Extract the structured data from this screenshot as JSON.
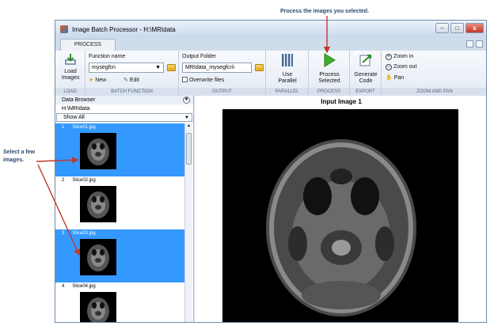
{
  "annotations": {
    "process_note": "Process the images you selected.",
    "select_note": "Select a few images."
  },
  "window": {
    "title": "Image Batch Processor - H:\\MRIdata",
    "buttons": [
      "–",
      "□",
      "x"
    ]
  },
  "tab": {
    "label": "PROCESS"
  },
  "sections": {
    "load": {
      "title": "LOAD",
      "button": "Load Images"
    },
    "batch_function": {
      "title": "BATCH FUNCTION",
      "label": "Function name",
      "value": "mysegfcn",
      "new": "New",
      "edit": "Edit"
    },
    "output": {
      "title": "OUTPUT",
      "label": "Output Folder",
      "value": "MRIdata_mysegfcn\\",
      "overwrite": "Overwrite files"
    },
    "parallel": {
      "title": "PARALLEL",
      "button": "Use Parallel"
    },
    "process": {
      "title": "PROCESS",
      "button": "Process Selected"
    },
    "export": {
      "title": "EXPORT",
      "button": "Generate Code"
    },
    "zoom_pan": {
      "title": "ZOOM AND PAN",
      "zoom_in": "Zoom in",
      "zoom_out": "Zoom out",
      "pan": "Pan"
    }
  },
  "data_browser": {
    "title": "Data Browser",
    "path": "H:\\MRIdata",
    "filter": "Show All",
    "items": [
      {
        "num": "1",
        "name": "Slice01.jpg",
        "selected": true
      },
      {
        "num": "2",
        "name": "Slice02.jpg",
        "selected": false
      },
      {
        "num": "3",
        "name": "Slice03.jpg",
        "selected": true
      },
      {
        "num": "4",
        "name": "Slice04.jpg",
        "selected": false
      }
    ]
  },
  "viewer": {
    "title": "Input Image 1"
  },
  "colors": {
    "selection": "#3399ff",
    "window_border": "#6f8aab",
    "annotation_text": "#2a4a72",
    "arrow": "#c0392b"
  }
}
